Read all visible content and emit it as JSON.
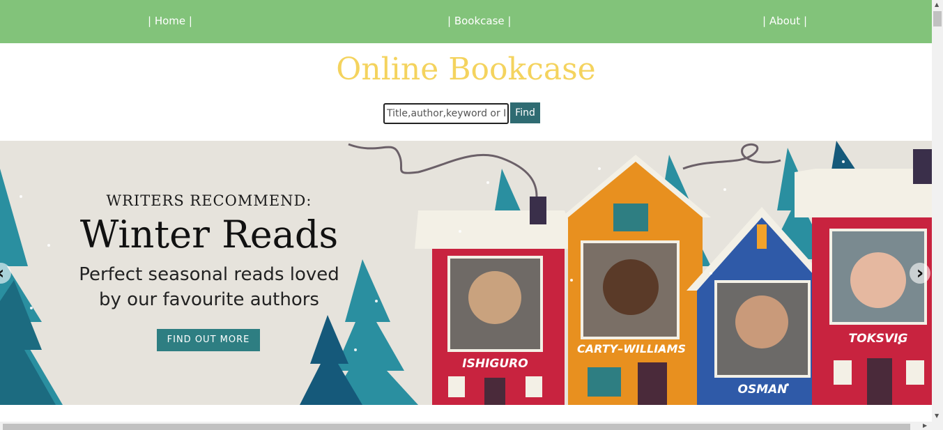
{
  "nav": {
    "home": "| Home |",
    "bookcase": "| Bookcase |",
    "about": "| About |"
  },
  "header": {
    "title": "Online Bookcase"
  },
  "search": {
    "placeholder": "Title,author,keyword or ISBN",
    "button": "Find"
  },
  "banner": {
    "eyebrow": "WRITERS RECOMMEND:",
    "headline": "Winter Reads",
    "subline1": "Perfect seasonal reads loved",
    "subline2": "by our favourite authors",
    "cta": "FIND OUT MORE",
    "authors": [
      "ISHIGURO",
      "CARTY–WILLIAMS",
      "OSMAN",
      "TOKSVIG"
    ]
  },
  "carousel": {
    "prev_icon": "chevron-left-icon",
    "next_icon": "chevron-right-icon"
  },
  "colors": {
    "nav_bg": "#82c37a",
    "title": "#f4d35e",
    "find_button": "#2f6b72",
    "cta": "#2e7e82"
  }
}
